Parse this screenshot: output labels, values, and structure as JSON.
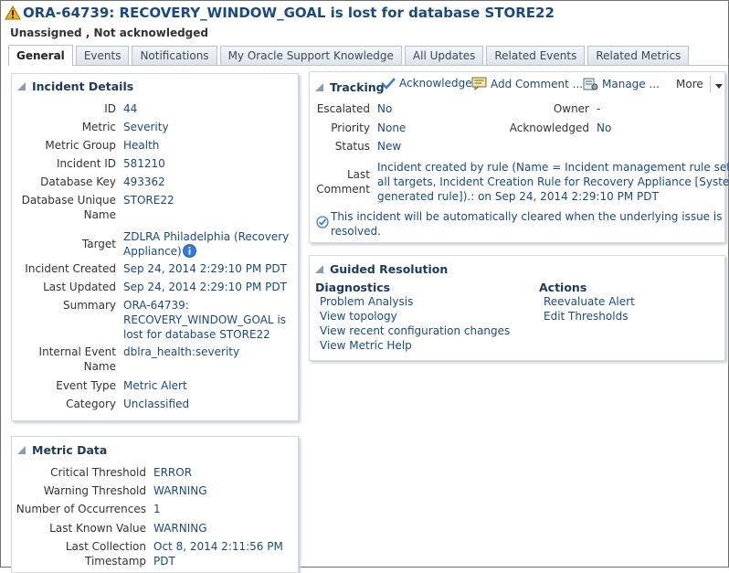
{
  "header": {
    "title": "ORA-64739: RECOVERY_WINDOW_GOAL is lost for database STORE22",
    "subtitle": "Unassigned , Not acknowledged"
  },
  "tabs": [
    {
      "label": "General"
    },
    {
      "label": "Events"
    },
    {
      "label": "Notifications"
    },
    {
      "label": "My Oracle Support Knowledge"
    },
    {
      "label": "All Updates"
    },
    {
      "label": "Related Events"
    },
    {
      "label": "Related Metrics"
    }
  ],
  "incident_details": {
    "title": "Incident Details",
    "id_label": "ID",
    "id": "44",
    "metric_label": "Metric",
    "metric": "Severity",
    "metric_group_label": "Metric Group",
    "metric_group": "Health",
    "incident_id_label": "Incident ID",
    "incident_id": "581210",
    "database_key_label": "Database Key",
    "database_key": "493362",
    "db_unique_name_label_1": "Database Unique",
    "db_unique_name_label_2": "Name",
    "db_unique_name": "STORE22",
    "target_label": "Target",
    "target_1": "ZDLRA Philadelphia (Recovery",
    "target_2": "Appliance)",
    "incident_created_label": "Incident Created",
    "incident_created": "Sep 24, 2014 2:29:10 PM PDT",
    "last_updated_label": "Last Updated",
    "last_updated": "Sep 24, 2014 2:29:10 PM PDT",
    "summary_label": "Summary",
    "summary_1": "ORA-64739:",
    "summary_2": "RECOVERY_WINDOW_GOAL is",
    "summary_3": "lost for database STORE22",
    "internal_event_label_1": "Internal Event",
    "internal_event_label_2": "Name",
    "internal_event": "dblra_health:severity",
    "event_type_label": "Event Type",
    "event_type": "Metric Alert",
    "category_label": "Category",
    "category": "Unclassified"
  },
  "metric_data": {
    "title": "Metric Data",
    "critical_label": "Critical Threshold",
    "critical": "ERROR",
    "warning_label": "Warning Threshold",
    "warning": "WARNING",
    "occurrences_label": "Number of Occurrences",
    "occurrences": "1",
    "last_value_label": "Last Known Value",
    "last_value": "WARNING",
    "last_collection_label_1": "Last Collection",
    "last_collection_label_2": "Timestamp",
    "last_collection_1": "Oct 8, 2014 2:11:56 PM",
    "last_collection_2": "PDT"
  },
  "tracking": {
    "title": "Tracking",
    "acknowledge": "Acknowledge",
    "add_comment": "Add Comment ...",
    "manage": "Manage ...",
    "more": "More",
    "escalated_label": "Escalated",
    "escalated": "No",
    "owner_label": "Owner",
    "owner": "-",
    "priority_label": "Priority",
    "priority": "None",
    "acknowledged_label": "Acknowledged",
    "acknowledged": "No",
    "status_label": "Status",
    "status": "New",
    "last_comment_label_1": "Last",
    "last_comment_label_2": "Comment",
    "last_comment_1": "Incident created by rule (Name = Incident management rule set for",
    "last_comment_2": "all targets, Incident Creation Rule for Recovery Appliance [System",
    "last_comment_3": "generated rule]).: on Sep 24, 2014 2:29:10 PM PDT",
    "auto_clear_1": "This incident will be automatically cleared when the underlying issue is",
    "auto_clear_2": "resolved."
  },
  "guided_resolution": {
    "title": "Guided Resolution",
    "diagnostics_title": "Diagnostics",
    "diagnostics": [
      "Problem Analysis",
      "View topology",
      "View recent configuration changes",
      "View Metric Help"
    ],
    "actions_title": "Actions",
    "actions": [
      "Reevaluate Alert",
      "Edit Thresholds"
    ]
  },
  "colors": {
    "link": "#1c4a7e",
    "warning_icon": "#f2b418",
    "panel_border": "#d3d9e0"
  },
  "icons": [
    "warning-icon",
    "info-icon",
    "checkmark-icon",
    "comment-icon",
    "manage-icon",
    "dropdown-arrow-icon",
    "collapse-triangle-icon",
    "auto-clear-icon"
  ]
}
